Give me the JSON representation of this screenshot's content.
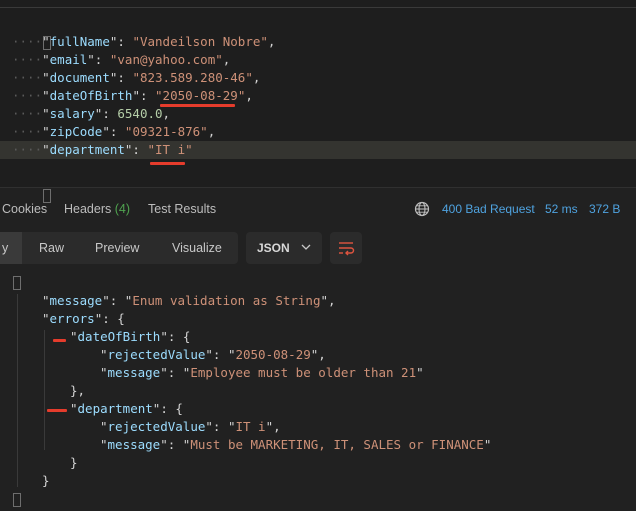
{
  "request_body": {
    "lines": [
      {
        "key": "fullName",
        "value": "Vandeilson Nobre",
        "type": "string"
      },
      {
        "key": "email",
        "value": "van@yahoo.com",
        "type": "string"
      },
      {
        "key": "document",
        "value": "823.589.280-46",
        "type": "string"
      },
      {
        "key": "dateOfBirth",
        "value": "2050-08-29",
        "type": "string"
      },
      {
        "key": "salary",
        "value": "6540.0",
        "type": "number"
      },
      {
        "key": "zipCode",
        "value": "09321-876",
        "type": "string"
      },
      {
        "key": "department",
        "value": "IT i",
        "type": "string"
      }
    ]
  },
  "response_tabs": {
    "cookies": "Cookies",
    "headers": "Headers",
    "headers_count": "(4)",
    "test_results": "Test Results"
  },
  "status": {
    "code_text": "400 Bad Request",
    "time": "52 ms",
    "size": "372 B",
    "code_color": "#4fa3e0"
  },
  "format_bar": {
    "pretty_partial": "y",
    "raw": "Raw",
    "preview": "Preview",
    "visualize": "Visualize",
    "format_select": "JSON",
    "chevron": "⌄"
  },
  "response_body": {
    "message_key": "message",
    "message_value": "Enum validation as String",
    "errors_key": "errors",
    "errors": [
      {
        "field": "dateOfBirth",
        "rejectedValue_key": "rejectedValue",
        "rejectedValue": "2050-08-29",
        "message_key": "message",
        "message": "Employee must be older than 21"
      },
      {
        "field": "department",
        "rejectedValue_key": "rejectedValue",
        "rejectedValue": "IT i",
        "message_key": "message",
        "message": "Must be MARKETING, IT, SALES or FINANCE"
      }
    ]
  }
}
